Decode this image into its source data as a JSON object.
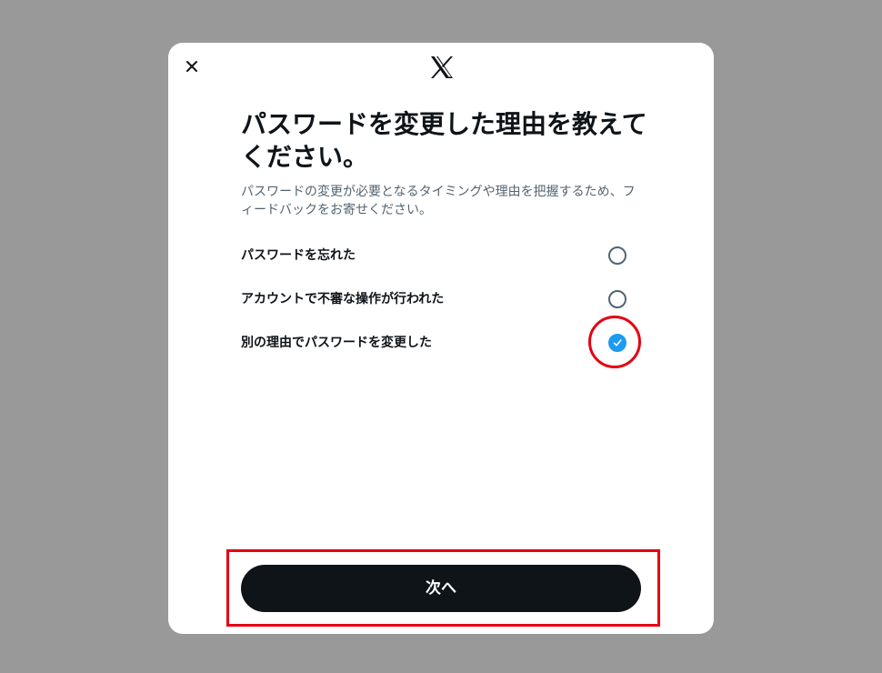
{
  "header": {
    "close_icon": "close-icon",
    "logo_icon": "x-logo-icon"
  },
  "title": "パスワードを変更した理由を教えてください。",
  "subtitle": "パスワードの変更が必要となるタイミングや理由を把握するため、フィードバックをお寄せください。",
  "options": [
    {
      "label": "パスワードを忘れた",
      "selected": false
    },
    {
      "label": "アカウントで不審な操作が行われた",
      "selected": false
    },
    {
      "label": "別の理由でパスワードを変更した",
      "selected": true
    }
  ],
  "next_button": {
    "label": "次へ"
  },
  "colors": {
    "overlay": "#999999",
    "primary_text": "#0f1419",
    "secondary_text": "#536471",
    "accent": "#1d9bf0",
    "annotation": "#e60012"
  }
}
